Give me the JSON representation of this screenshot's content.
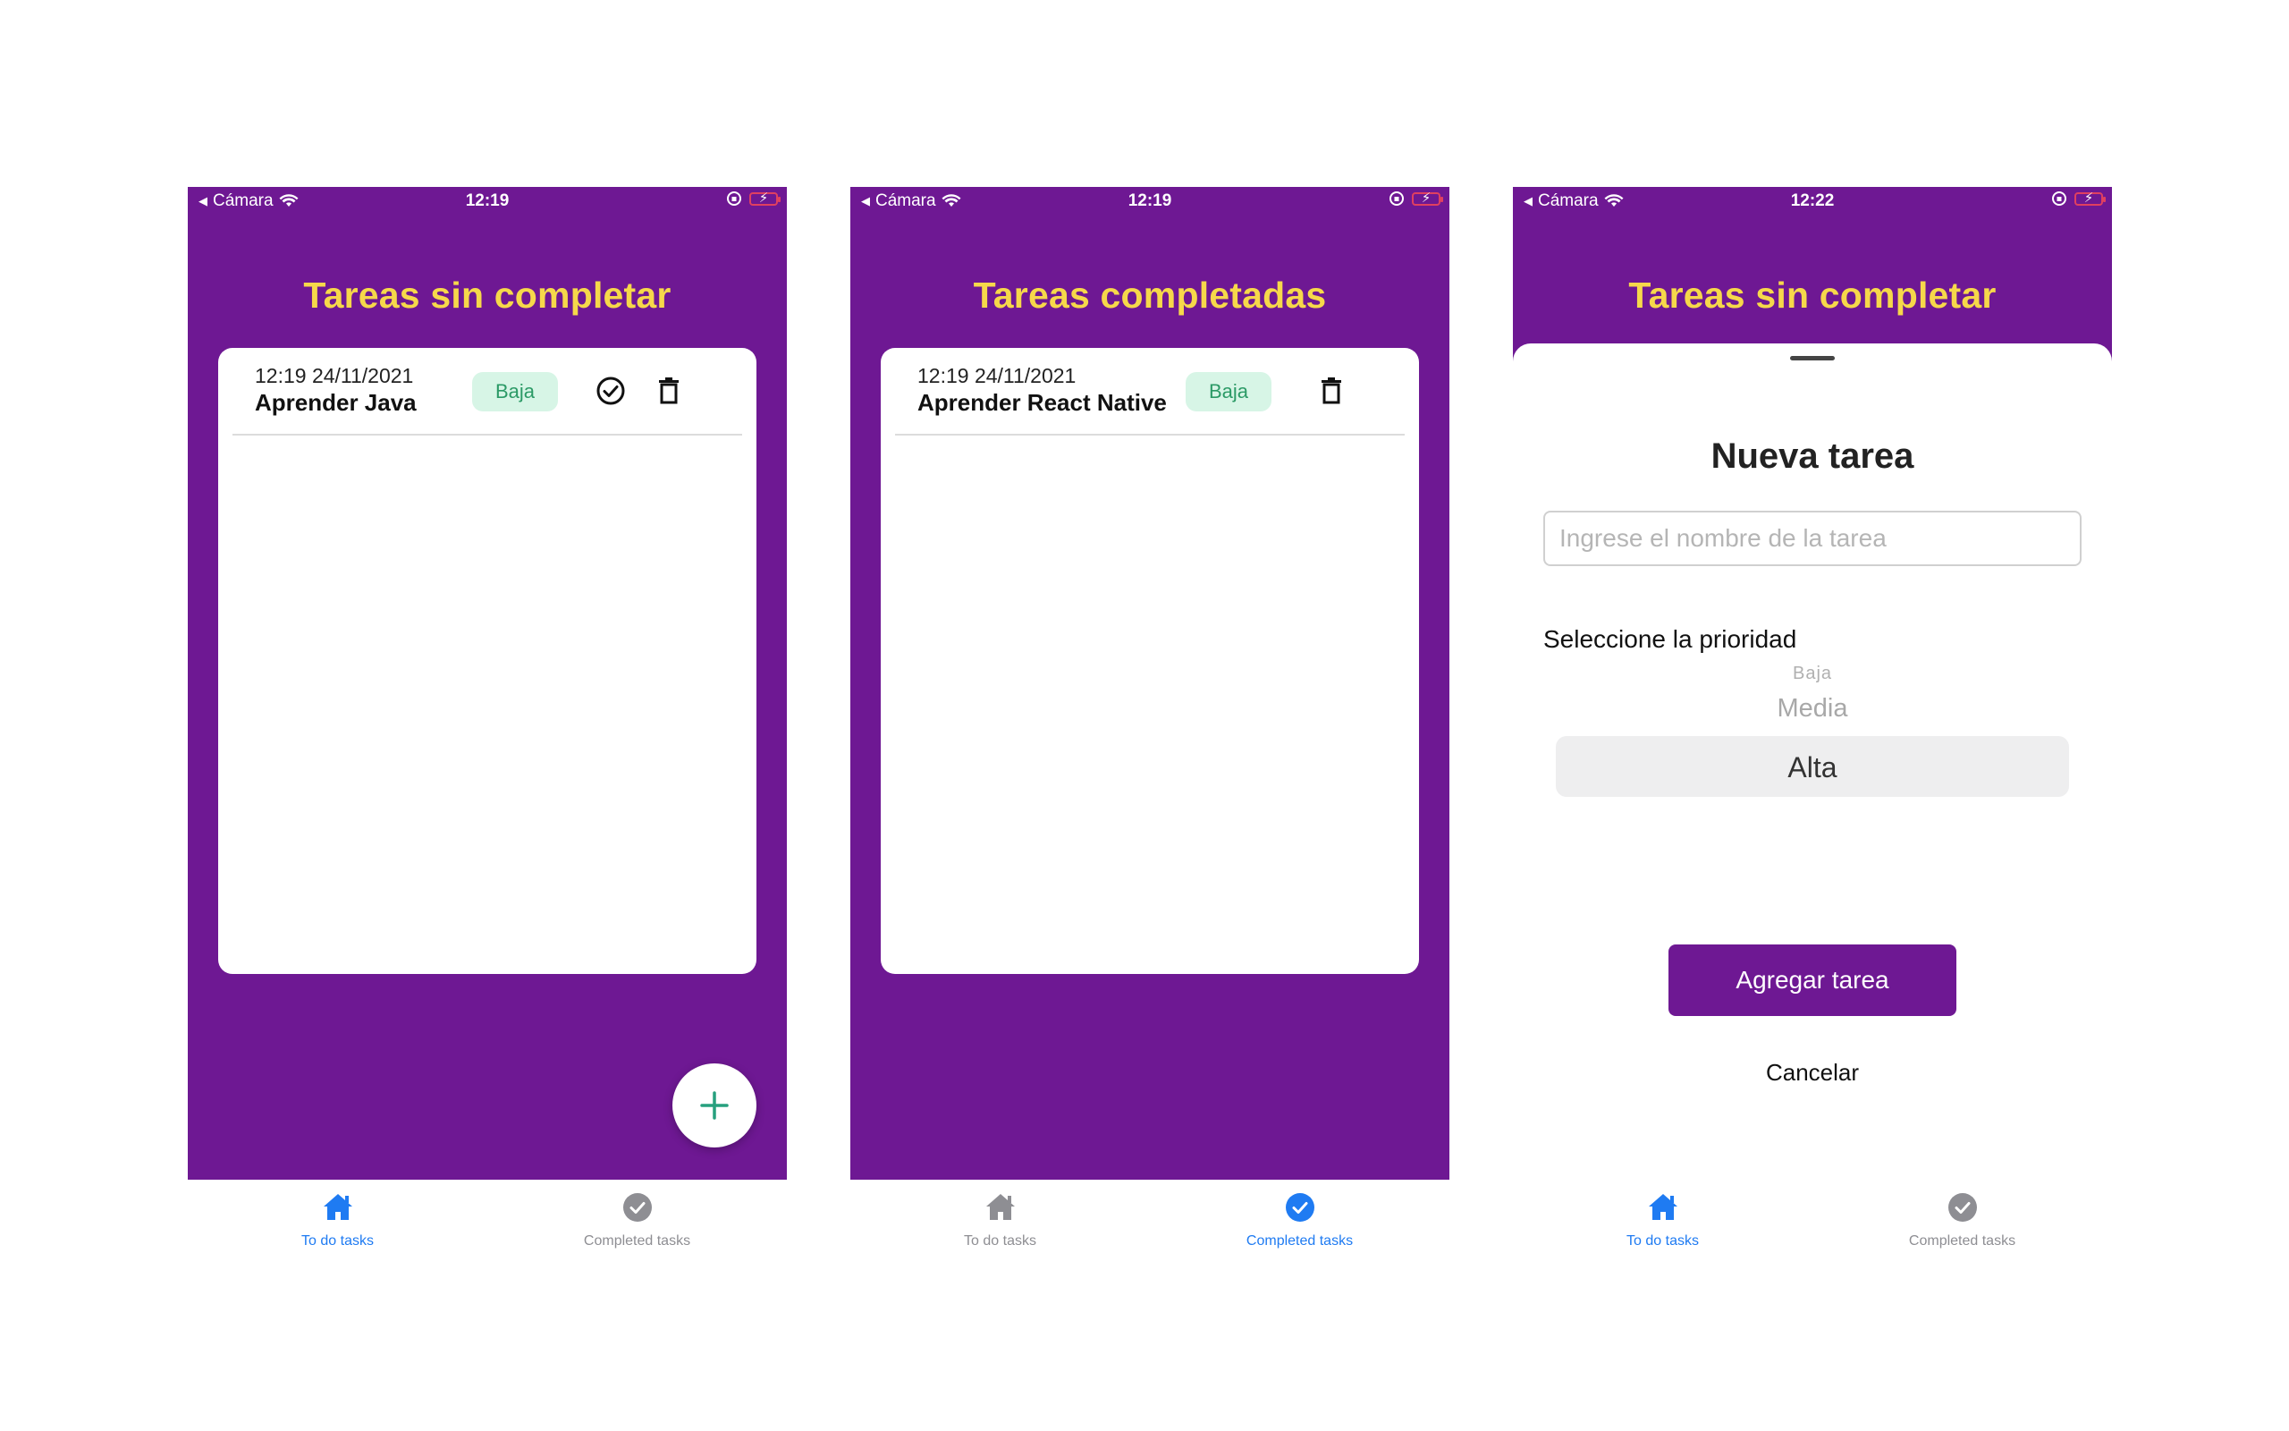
{
  "statusbar": {
    "carrier": "Cámara",
    "times": [
      "12:19",
      "12:19",
      "12:22"
    ]
  },
  "screen1": {
    "title": "Tareas sin completar",
    "tasks": [
      {
        "date": "12:19 24/11/2021",
        "name": "Aprender Java",
        "priority": "Baja"
      }
    ],
    "fab_icon": "plus-icon"
  },
  "screen2": {
    "title": "Tareas completadas",
    "tasks": [
      {
        "date": "12:19 24/11/2021",
        "name": "Aprender React Native",
        "priority": "Baja"
      }
    ]
  },
  "screen3": {
    "title": "Tareas sin completar",
    "modal": {
      "title": "Nueva tarea",
      "input_value": "",
      "input_placeholder": "Ingrese el nombre de la tarea",
      "priority_label": "Seleccione la prioridad",
      "options": [
        "Baja",
        "Media",
        "Alta"
      ],
      "selected": "Alta",
      "add_label": "Agregar tarea",
      "cancel_label": "Cancelar"
    }
  },
  "tabs": [
    {
      "label": "To do tasks",
      "icon": "home-icon"
    },
    {
      "label": "Completed tasks",
      "icon": "check-circle-icon"
    }
  ],
  "colors": {
    "header": "#6e1893",
    "title": "#f6d84a",
    "badge_bg": "#d7f5e6",
    "badge_text": "#2b9a66",
    "tab_active": "#1f7bf2",
    "tab_inactive": "#8e8e93",
    "fab_plus": "#27a07e"
  }
}
